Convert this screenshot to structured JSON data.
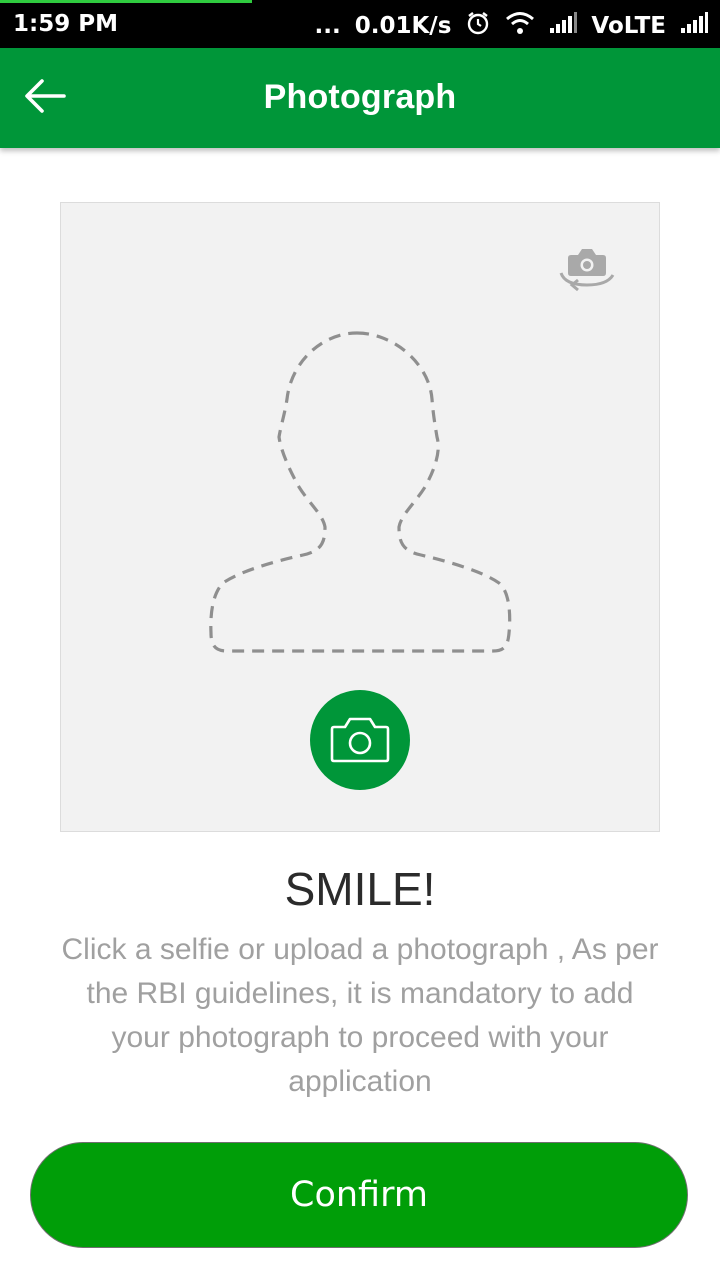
{
  "status_bar": {
    "time": "1:59 PM",
    "dots": "...",
    "network_speed": "0.01K/s",
    "icons": [
      "alarm-icon",
      "wifi-icon",
      "signal-icon",
      "signal-icon"
    ],
    "volte": "VoLTE"
  },
  "app_bar": {
    "title": "Photograph",
    "back_icon": "arrow-left-icon",
    "color": "#009639"
  },
  "photo_area": {
    "switch_camera_icon": "switch-camera-icon",
    "placeholder_icon": "person-silhouette-icon",
    "capture_icon": "camera-icon"
  },
  "content": {
    "heading": "SMILE!",
    "description": "Click a selfie or upload a photograph , As per the RBI guidelines, it is mandatory to add your photograph to proceed with your application"
  },
  "actions": {
    "confirm_label": "Confirm",
    "confirm_color": "#009e08"
  }
}
